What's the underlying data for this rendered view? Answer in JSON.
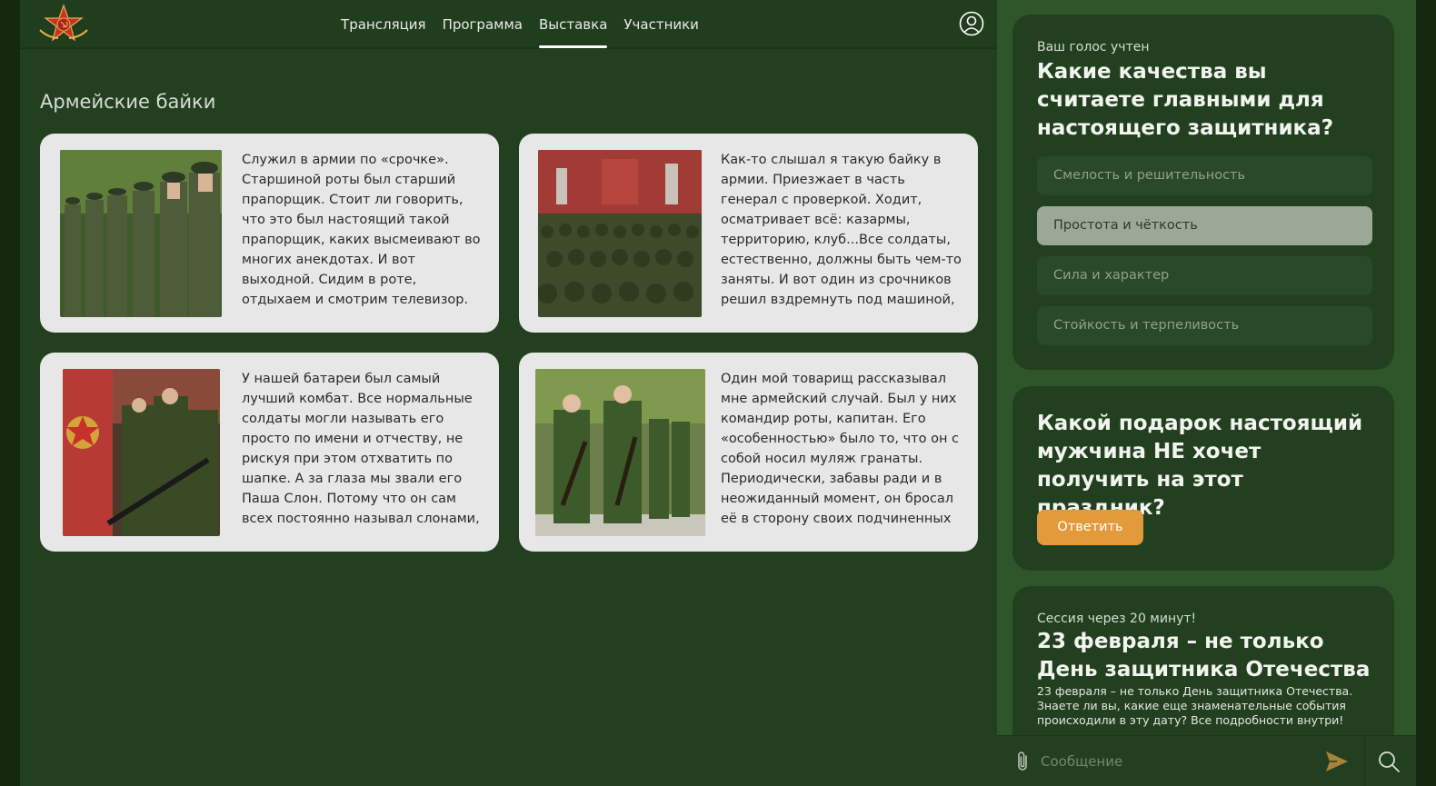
{
  "nav": {
    "items": [
      {
        "label": "Трансляция"
      },
      {
        "label": "Программа"
      },
      {
        "label": "Выставка",
        "active": true
      },
      {
        "label": "Участники"
      }
    ]
  },
  "section": {
    "title": "Армейские байки"
  },
  "stories": [
    {
      "text": "Служил в армии по «срочке». Старшиной роты был старший прапорщик. Стоит ли говорить, что это был настоящий такой прапорщик, каких высмеивают во многих анекдотах. И вот выходной. Сидим в роте, отдыхаем и смотрим телевизор. Старшина"
    },
    {
      "text": "Как-то слышал я такую байку в армии. Приезжает в часть генерал с проверкой. Ходит, осматривает всё: казармы, территорию, клуб...Все солдаты, естественно, должны быть чем-то заняты. И вот один из срочников решил вздремнуть под машиной, привязав руки к днищу,"
    },
    {
      "text": "У нашей батареи был самый лучший комбат. Все нормальные солдаты могли называть его просто по имени и отчеству, не рискуя при этом отхватить по шапке. А за глаза мы звали его Паша Слон. Потому что он сам всех постоянно называл слонами, ну и выглядел"
    },
    {
      "text": "Один мой товарищ рассказывал мне армейский случай. Был у них командир роты, капитан. Его «особенностью» было то, что он с собой носил муляж гранаты. Периодически, забавы ради и в неожиданный момент, он бросал её в сторону своих подчиненных с"
    }
  ],
  "poll1": {
    "status": "Ваш голос учтен",
    "question": "Какие качества вы считаете главными для настоящего защитника?",
    "options": [
      {
        "label": "Смелость и решительность"
      },
      {
        "label": "Простота и чёткость",
        "selected": true
      },
      {
        "label": "Сила и характер"
      },
      {
        "label": "Стойкость и терпеливость"
      }
    ]
  },
  "poll2": {
    "question": "Какой подарок настоящий мужчина НЕ хочет получить на этот праздник?",
    "button": "Ответить"
  },
  "session": {
    "status": "Сессия через 20 минут!",
    "title": "23 февраля – не только День защитника Отечества",
    "description": "23 февраля – не только День защитника Отечества. Знаете ли вы, какие еще знаменательные события происходили в эту дату? Все подробности внутри!"
  },
  "message": {
    "placeholder": "Сообщение"
  },
  "colors": {
    "accent": "#e39a3b",
    "background": "#22401f",
    "sidebar": "#2f562a"
  }
}
